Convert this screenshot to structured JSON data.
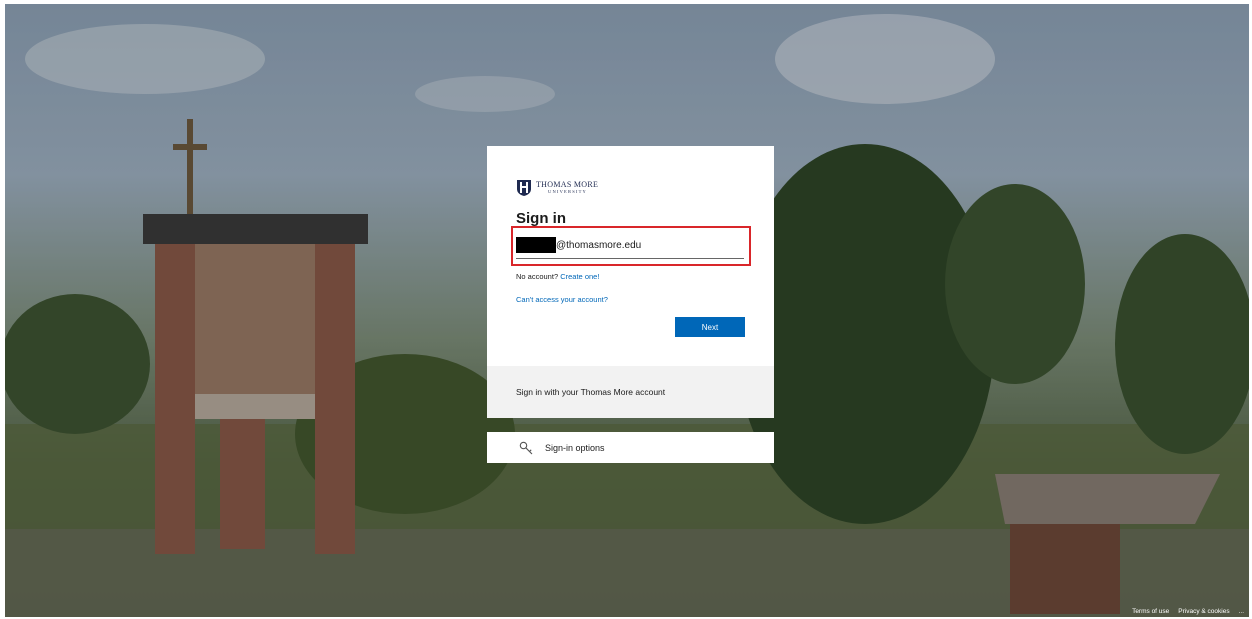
{
  "branding": {
    "logo_line1": "THOMAS MORE",
    "logo_line2": "UNIVERSITY"
  },
  "signin": {
    "title": "Sign in",
    "email_value": "@thomasmore.edu",
    "no_account_text": "No account?",
    "create_link": "Create one!",
    "cant_access": "Can't access your account?",
    "next_label": "Next",
    "footer_text": "Sign in with your Thomas More account"
  },
  "options": {
    "label": "Sign-in options",
    "icon": "key-icon"
  },
  "footer": {
    "terms": "Terms of use",
    "privacy": "Privacy & cookies",
    "more": "..."
  },
  "colors": {
    "accent": "#0067b8",
    "highlight_border": "#d9262a"
  }
}
